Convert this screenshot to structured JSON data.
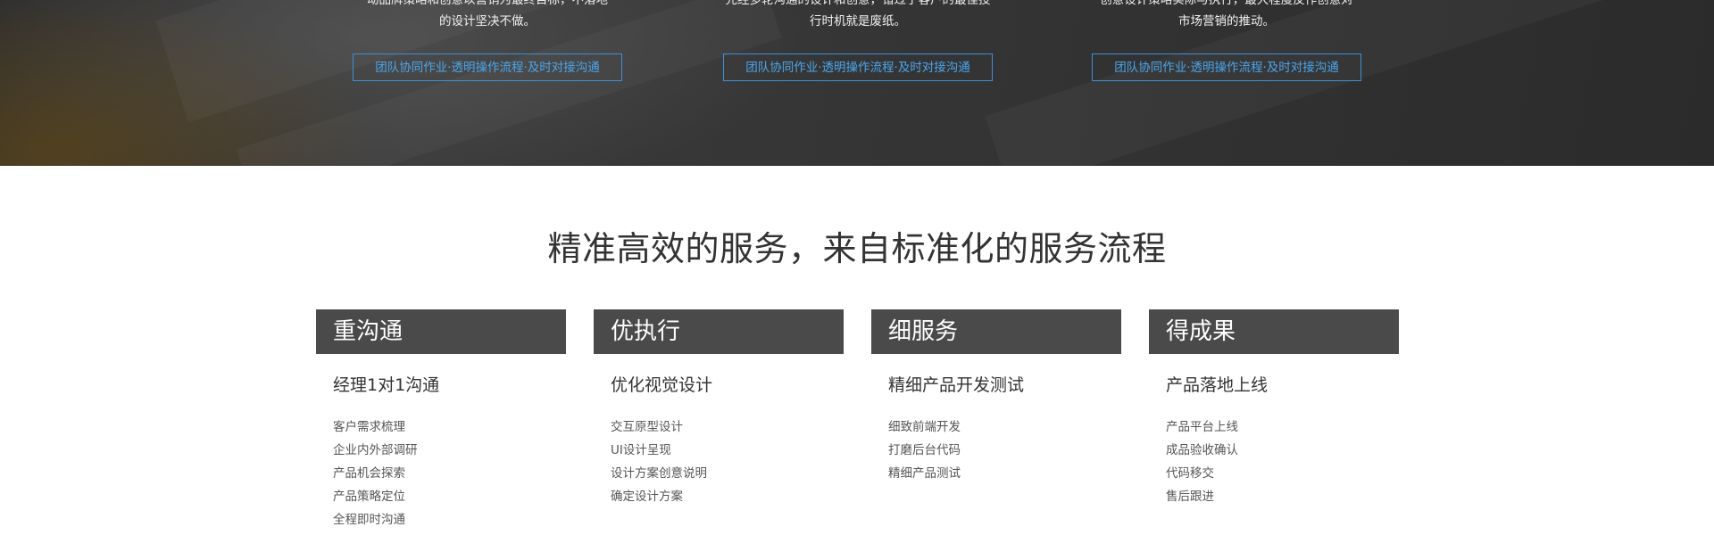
{
  "hero": {
    "columns": [
      {
        "desc_lines": [
          "动品牌策略和创意以营销为最终目标，不落地",
          "的设计坚决不做。"
        ],
        "button_label": "团队协同作业·透明操作流程·及时对接沟通"
      },
      {
        "desc_lines": [
          "先经多轮沟通的设计和创意，错过了客户的最佳投",
          "行时机就是废纸。"
        ],
        "button_label": "团队协同作业·透明操作流程·及时对接沟通"
      },
      {
        "desc_lines": [
          "创意设计策略实际与执行，最大程度反作创意对",
          "市场营销的推动。"
        ],
        "button_label": "团队协同作业·透明操作流程·及时对接沟通"
      }
    ]
  },
  "section": {
    "title": "精准高效的服务，来自标准化的服务流程",
    "cards": [
      {
        "heading": "重沟通",
        "subtitle": "经理1对1沟通",
        "items": [
          "客户需求梳理",
          "企业内外部调研",
          "产品机会探索",
          "产品策略定位",
          "全程即时沟通"
        ]
      },
      {
        "heading": "优执行",
        "subtitle": "优化视觉设计",
        "items": [
          "交互原型设计",
          "UI设计呈现",
          "设计方案创意说明",
          "确定设计方案"
        ]
      },
      {
        "heading": "细服务",
        "subtitle": "精细产品开发测试",
        "items": [
          "细致前端开发",
          "打磨后台代码",
          "精细产品测试"
        ]
      },
      {
        "heading": "得成果",
        "subtitle": "产品落地上线",
        "items": [
          "产品平台上线",
          "成品验收确认",
          "代码移交",
          "售后跟进"
        ]
      }
    ]
  }
}
